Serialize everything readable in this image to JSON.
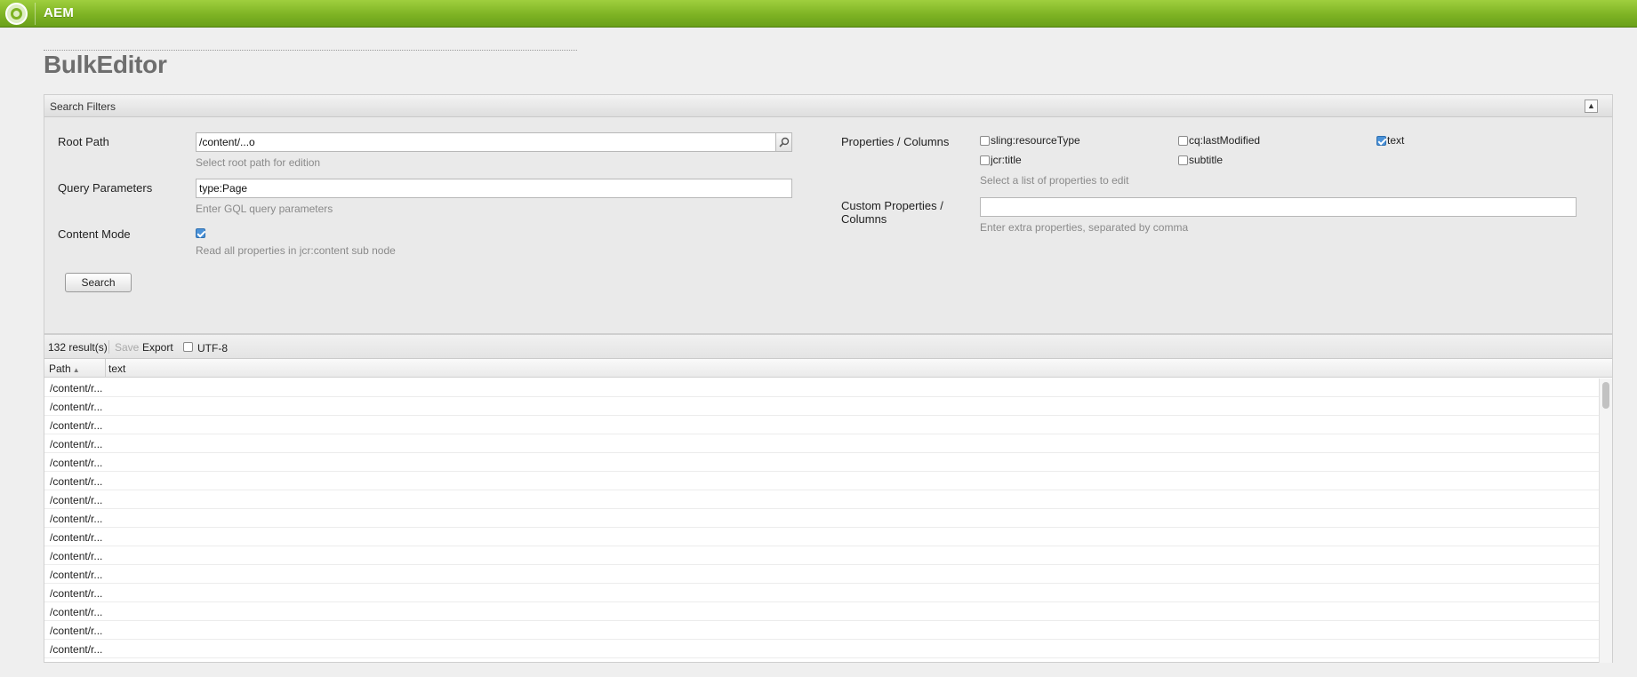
{
  "app": {
    "name": "AEM"
  },
  "page": {
    "title": "BulkEditor"
  },
  "filters": {
    "header": "Search Filters",
    "root_path": {
      "label": "Root Path",
      "value": "/content/...o",
      "hint": "Select root path for edition"
    },
    "query_params": {
      "label": "Query Parameters",
      "value": "type:Page",
      "hint": "Enter GQL query parameters"
    },
    "content_mode": {
      "label": "Content Mode",
      "checked": true,
      "hint": "Read all properties in jcr:content sub node"
    },
    "search_button": "Search",
    "properties": {
      "label": "Properties / Columns",
      "hint": "Select a list of properties to edit",
      "options": [
        {
          "label": "sling:resourceType",
          "checked": false
        },
        {
          "label": "cq:lastModified",
          "checked": false
        },
        {
          "label": "text",
          "checked": true
        },
        {
          "label": "jcr:title",
          "checked": false
        },
        {
          "label": "subtitle",
          "checked": false
        }
      ]
    },
    "custom_properties": {
      "label_line1": "Custom Properties /",
      "label_line2": "Columns",
      "value": "",
      "hint": "Enter extra properties, separated by comma"
    }
  },
  "results": {
    "count": "132 result(s)",
    "save": "Save",
    "export": "Export",
    "utf8": "UTF-8",
    "columns": [
      "Path",
      "text"
    ],
    "rows": [
      "/content/r...",
      "/content/r...",
      "/content/r...",
      "/content/r...",
      "/content/r...",
      "/content/r...",
      "/content/r...",
      "/content/r...",
      "/content/r...",
      "/content/r...",
      "/content/r...",
      "/content/r...",
      "/content/r...",
      "/content/r...",
      "/content/r..."
    ]
  },
  "colors": {
    "topbar": "#7eb324",
    "checkbox_checked": "#4b92d8"
  },
  "icons": {
    "logo": "aem-logo-icon",
    "search": "search-icon",
    "collapse": "collapse-icon",
    "sort": "sort-asc-icon"
  }
}
